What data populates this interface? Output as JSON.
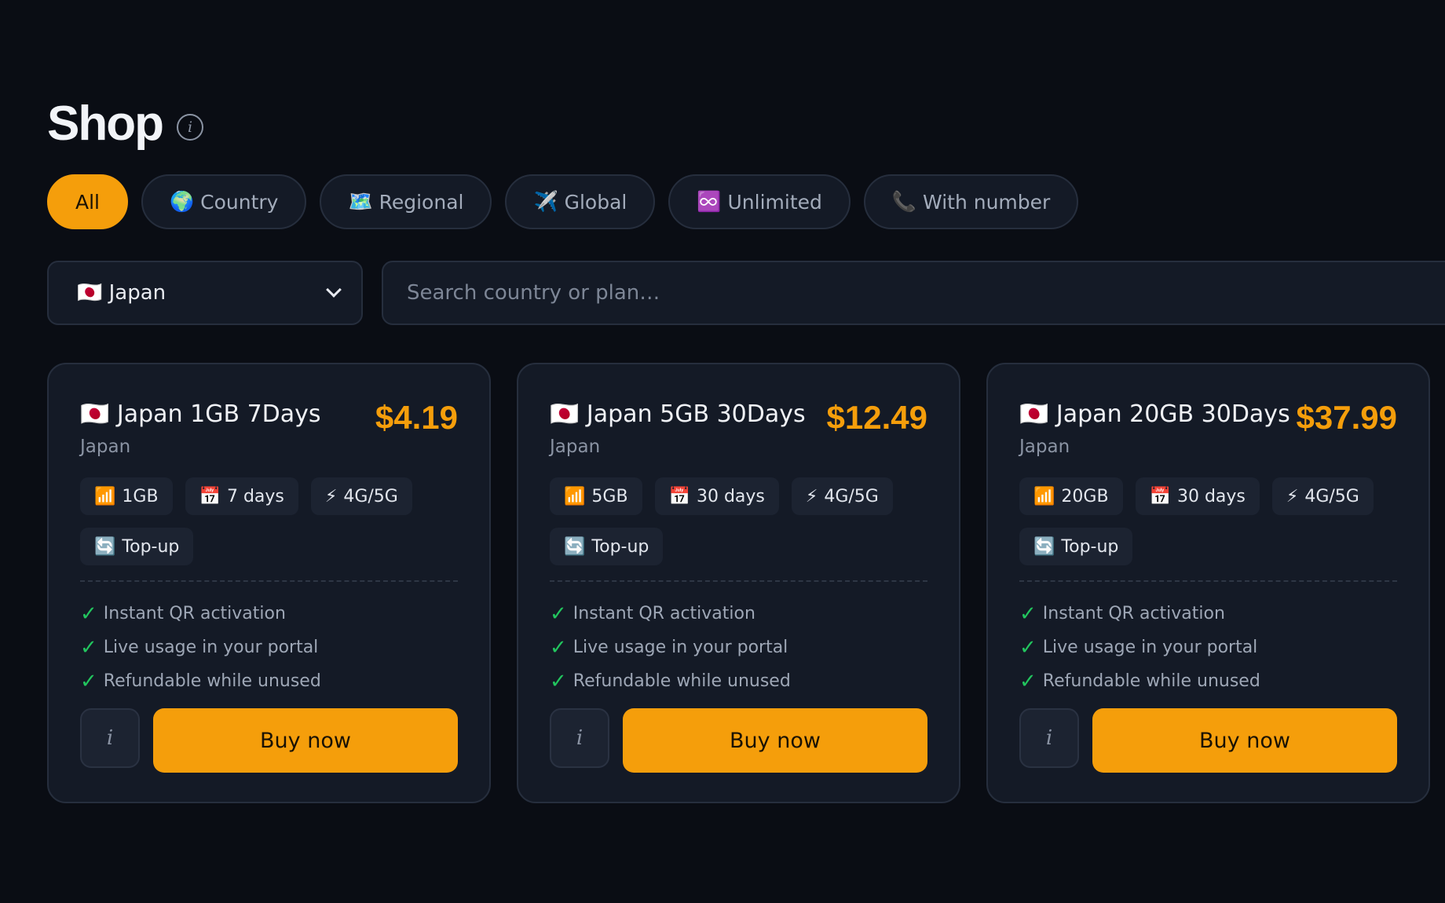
{
  "header": {
    "title": "Shop",
    "info_glyph": "i"
  },
  "filters": [
    {
      "icon": "🌍",
      "icon_name": "globe-icon",
      "label": "All",
      "active": true,
      "show_icon": false
    },
    {
      "icon": "🌍",
      "icon_name": "globe-icon",
      "label": "Country",
      "active": false,
      "show_icon": true
    },
    {
      "icon": "🗺️",
      "icon_name": "map-icon",
      "label": "Regional",
      "active": false,
      "show_icon": true
    },
    {
      "icon": "✈️",
      "icon_name": "airplane-icon",
      "label": "Global",
      "active": false,
      "show_icon": true
    },
    {
      "icon": "♾️",
      "icon_name": "infinity-icon",
      "label": "Unlimited",
      "active": false,
      "show_icon": true
    },
    {
      "icon": "📞",
      "icon_name": "phone-icon",
      "label": "With number",
      "active": false,
      "show_icon": true
    }
  ],
  "country_select": {
    "flag": "🇯🇵",
    "value": "Japan"
  },
  "search": {
    "placeholder": "Search country or plan…",
    "value": ""
  },
  "plans": [
    {
      "flag": "🇯🇵",
      "name": "Japan 1GB 7Days",
      "price": "$4.19",
      "country": "Japan",
      "tags": [
        {
          "icon": "📶",
          "icon_name": "signal-icon",
          "label": "1GB"
        },
        {
          "icon": "📅",
          "icon_name": "calendar-icon",
          "label": "7 days"
        },
        {
          "icon": "⚡",
          "icon_name": "lightning-icon",
          "label": "4G/5G"
        },
        {
          "icon": "🔄",
          "icon_name": "refresh-icon",
          "label": "Top-up"
        }
      ],
      "features": [
        "Instant QR activation",
        "Live usage in your portal",
        "Refundable while unused"
      ],
      "info_label": "i",
      "buy_label": "Buy now"
    },
    {
      "flag": "🇯🇵",
      "name": "Japan 5GB 30Days",
      "price": "$12.49",
      "country": "Japan",
      "tags": [
        {
          "icon": "📶",
          "icon_name": "signal-icon",
          "label": "5GB"
        },
        {
          "icon": "📅",
          "icon_name": "calendar-icon",
          "label": "30 days"
        },
        {
          "icon": "⚡",
          "icon_name": "lightning-icon",
          "label": "4G/5G"
        },
        {
          "icon": "🔄",
          "icon_name": "refresh-icon",
          "label": "Top-up"
        }
      ],
      "features": [
        "Instant QR activation",
        "Live usage in your portal",
        "Refundable while unused"
      ],
      "info_label": "i",
      "buy_label": "Buy now"
    },
    {
      "flag": "🇯🇵",
      "name": "Japan 20GB 30Days",
      "price": "$37.99",
      "country": "Japan",
      "tags": [
        {
          "icon": "📶",
          "icon_name": "signal-icon",
          "label": "20GB"
        },
        {
          "icon": "📅",
          "icon_name": "calendar-icon",
          "label": "30 days"
        },
        {
          "icon": "⚡",
          "icon_name": "lightning-icon",
          "label": "4G/5G"
        },
        {
          "icon": "🔄",
          "icon_name": "refresh-icon",
          "label": "Top-up"
        }
      ],
      "features": [
        "Instant QR activation",
        "Live usage in your portal",
        "Refundable while unused"
      ],
      "info_label": "i",
      "buy_label": "Buy now"
    }
  ],
  "colors": {
    "background": "#0a0d14",
    "surface": "#141a26",
    "accent": "#f59e0b",
    "check": "#22c55e",
    "muted_text": "#8a93a3"
  }
}
